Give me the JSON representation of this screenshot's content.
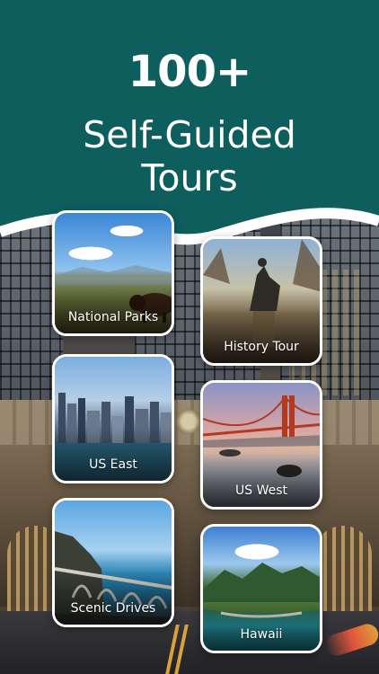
{
  "header": {
    "line1": "100+",
    "line2": "Self-Guided",
    "line3": "Tours",
    "color": "#0e5e5e"
  },
  "tours": [
    {
      "label": "National Parks"
    },
    {
      "label": "History Tour"
    },
    {
      "label": "US East"
    },
    {
      "label": "US West"
    },
    {
      "label": "Scenic Drives"
    },
    {
      "label": "Hawaii"
    }
  ]
}
